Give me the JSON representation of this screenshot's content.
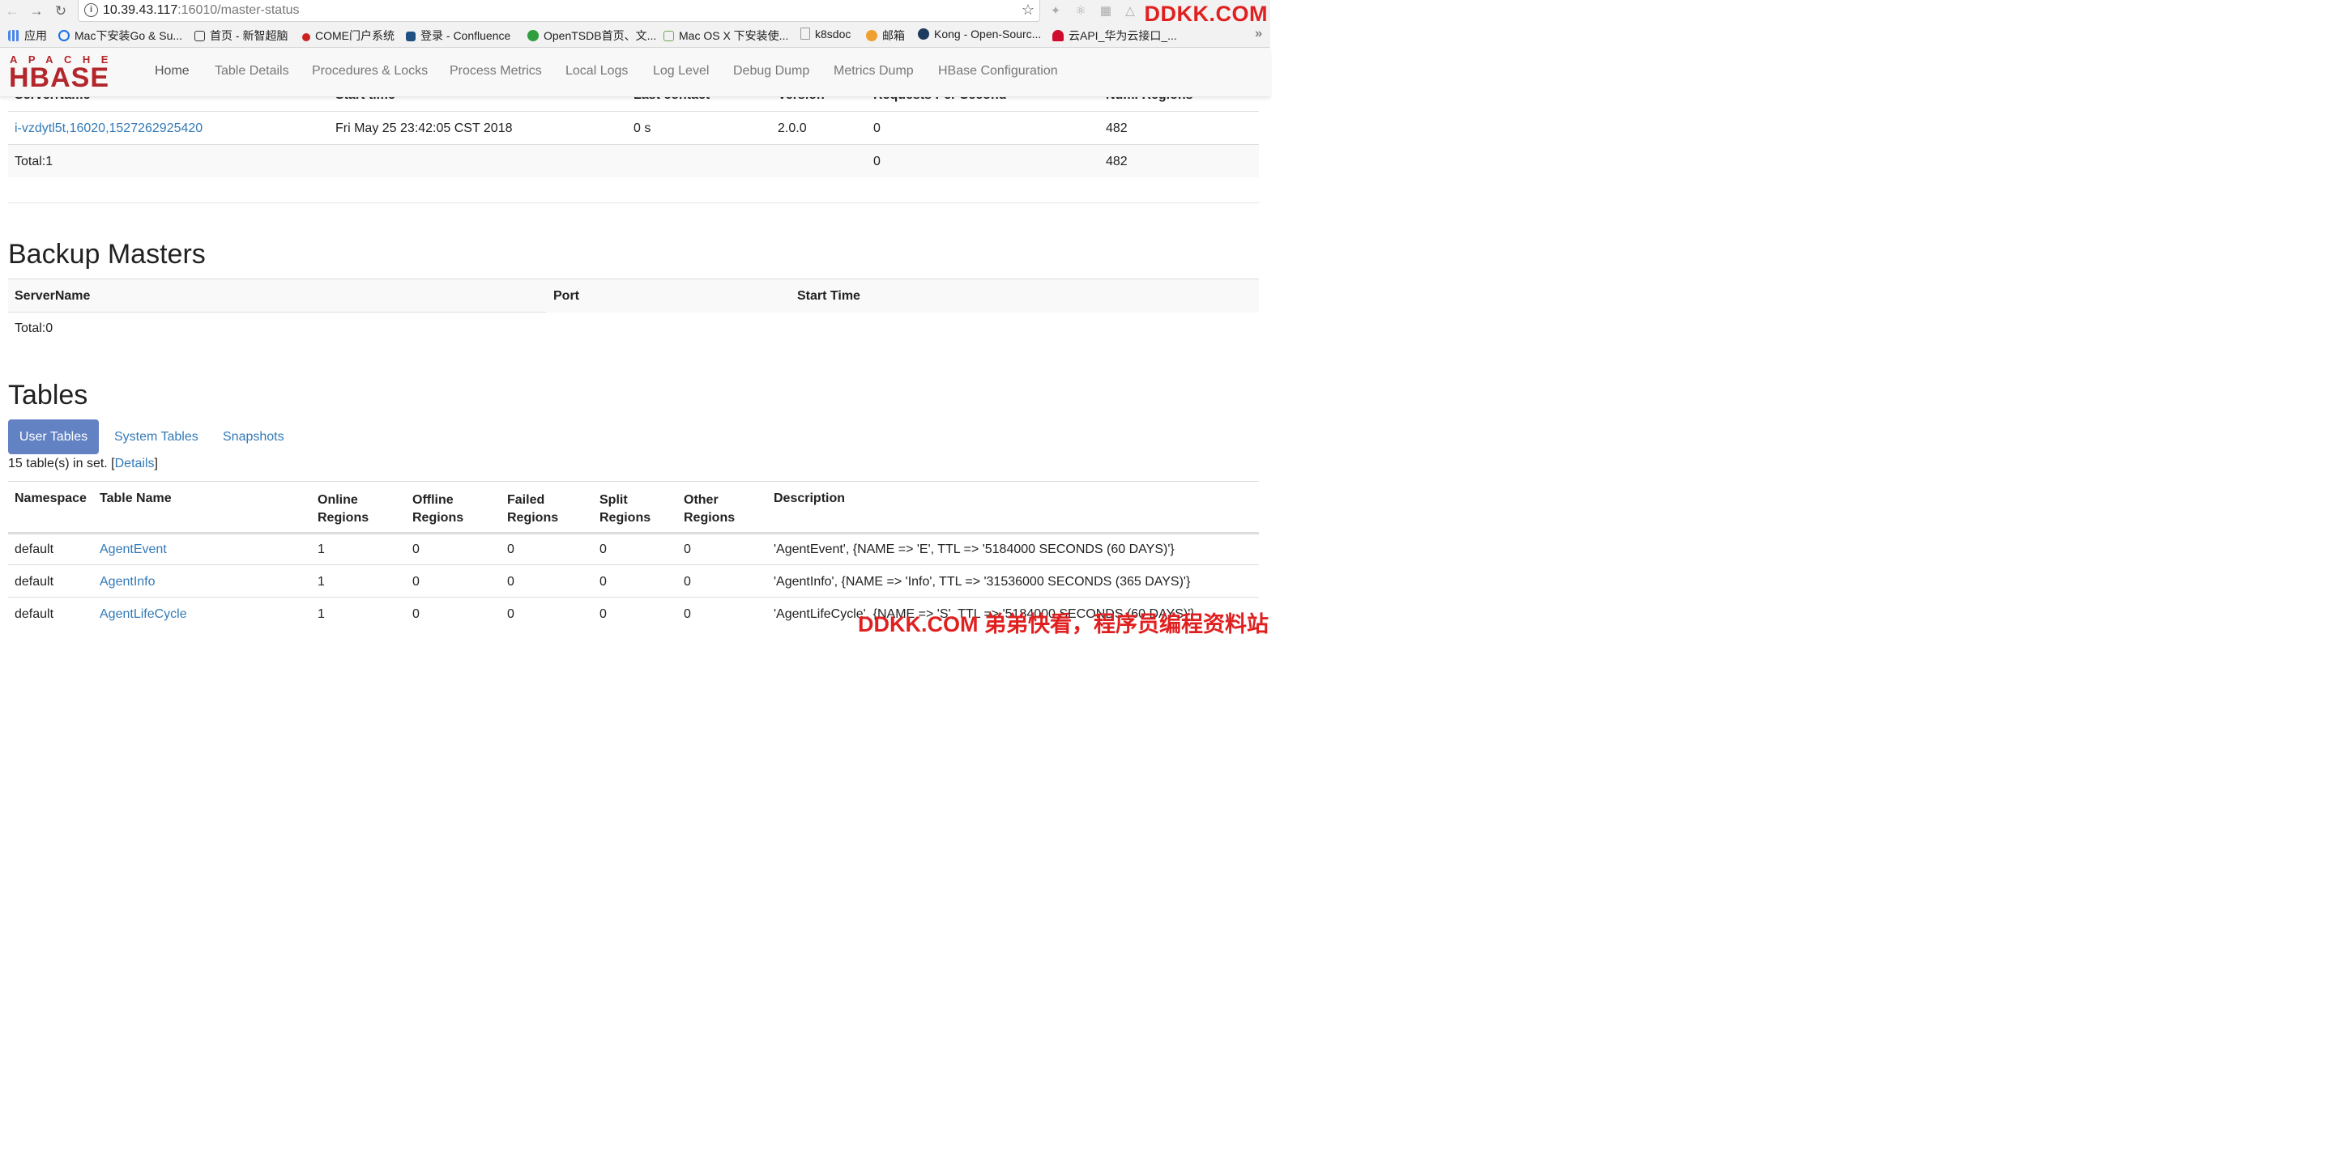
{
  "browser": {
    "url_host": "10.39.43.117",
    "url_rest": ":16010/master-status",
    "watermark_top": "DDKK.COM",
    "bookmarks": [
      {
        "label": "应用",
        "color": "#4a86e8"
      },
      {
        "label": "Mac下安装Go & Su...",
        "color": "#1a73e8"
      },
      {
        "label": "首页 - 新智超脑",
        "color": "#333333"
      },
      {
        "label": "COME门户系统",
        "color": "#cc2222"
      },
      {
        "label": "登录 - Confluence",
        "color": "#205081"
      },
      {
        "label": "OpenTSDB首页、文...",
        "color": "#2e9e3e"
      },
      {
        "label": "Mac OS X 下安装使...",
        "color": "#6aa84f"
      },
      {
        "label": "k8sdoc",
        "color": "#999999"
      },
      {
        "label": "邮箱",
        "color": "#f0a030"
      },
      {
        "label": "Kong - Open-Sourc...",
        "color": "#1f3a5f"
      },
      {
        "label": "云API_华为云接口_...",
        "color": "#cf0a2c"
      }
    ]
  },
  "app": {
    "logo_top": "APACHE",
    "logo_main": "HBASE",
    "nav": [
      "Home",
      "Table Details",
      "Procedures & Locks",
      "Process Metrics",
      "Local Logs",
      "Log Level",
      "Debug Dump",
      "Metrics Dump",
      "HBase Configuration"
    ]
  },
  "region_servers": {
    "headers": [
      "ServerName",
      "Start time",
      "Last contact",
      "Version",
      "Requests Per Second",
      "Num. Regions"
    ],
    "row": {
      "server": "i-vzdytl5t,16020,1527262925420",
      "start": "Fri May 25 23:42:05 CST 2018",
      "contact": "0 s",
      "version": "2.0.0",
      "rps": "0",
      "regions": "482"
    },
    "total": {
      "label": "Total:1",
      "rps": "0",
      "regions": "482"
    }
  },
  "backup_masters": {
    "title": "Backup Masters",
    "headers": [
      "ServerName",
      "Port",
      "Start Time"
    ],
    "total": "Total:0"
  },
  "tables": {
    "title": "Tables",
    "tabs": [
      "User Tables",
      "System Tables",
      "Snapshots"
    ],
    "summary_prefix": "15 table(s) in set. [",
    "summary_link": "Details",
    "summary_suffix": "]",
    "headers": [
      "Namespace",
      "Table Name",
      "Online",
      "Regions",
      "Offline",
      "Regions",
      "Failed",
      "Regions",
      "Split",
      "Regions",
      "Other",
      "Regions",
      "Description"
    ],
    "rows": [
      {
        "ns": "default",
        "name": "AgentEvent",
        "online": "1",
        "offline": "0",
        "failed": "0",
        "split": "0",
        "other": "0",
        "desc": "'AgentEvent', {NAME => 'E', TTL => '5184000 SECONDS (60 DAYS)'}"
      },
      {
        "ns": "default",
        "name": "AgentInfo",
        "online": "1",
        "offline": "0",
        "failed": "0",
        "split": "0",
        "other": "0",
        "desc": "'AgentInfo', {NAME => 'Info', TTL => '31536000 SECONDS (365 DAYS)'}"
      },
      {
        "ns": "default",
        "name": "AgentLifeCycle",
        "online": "1",
        "offline": "0",
        "failed": "0",
        "split": "0",
        "other": "0",
        "desc": "'AgentLifeCycle', {NAME => 'S', TTL => '5184000 SECONDS (60 DAYS)'}"
      }
    ]
  },
  "watermark_bottom": "DDKK.COM 弟弟快看，程序员编程资料站"
}
